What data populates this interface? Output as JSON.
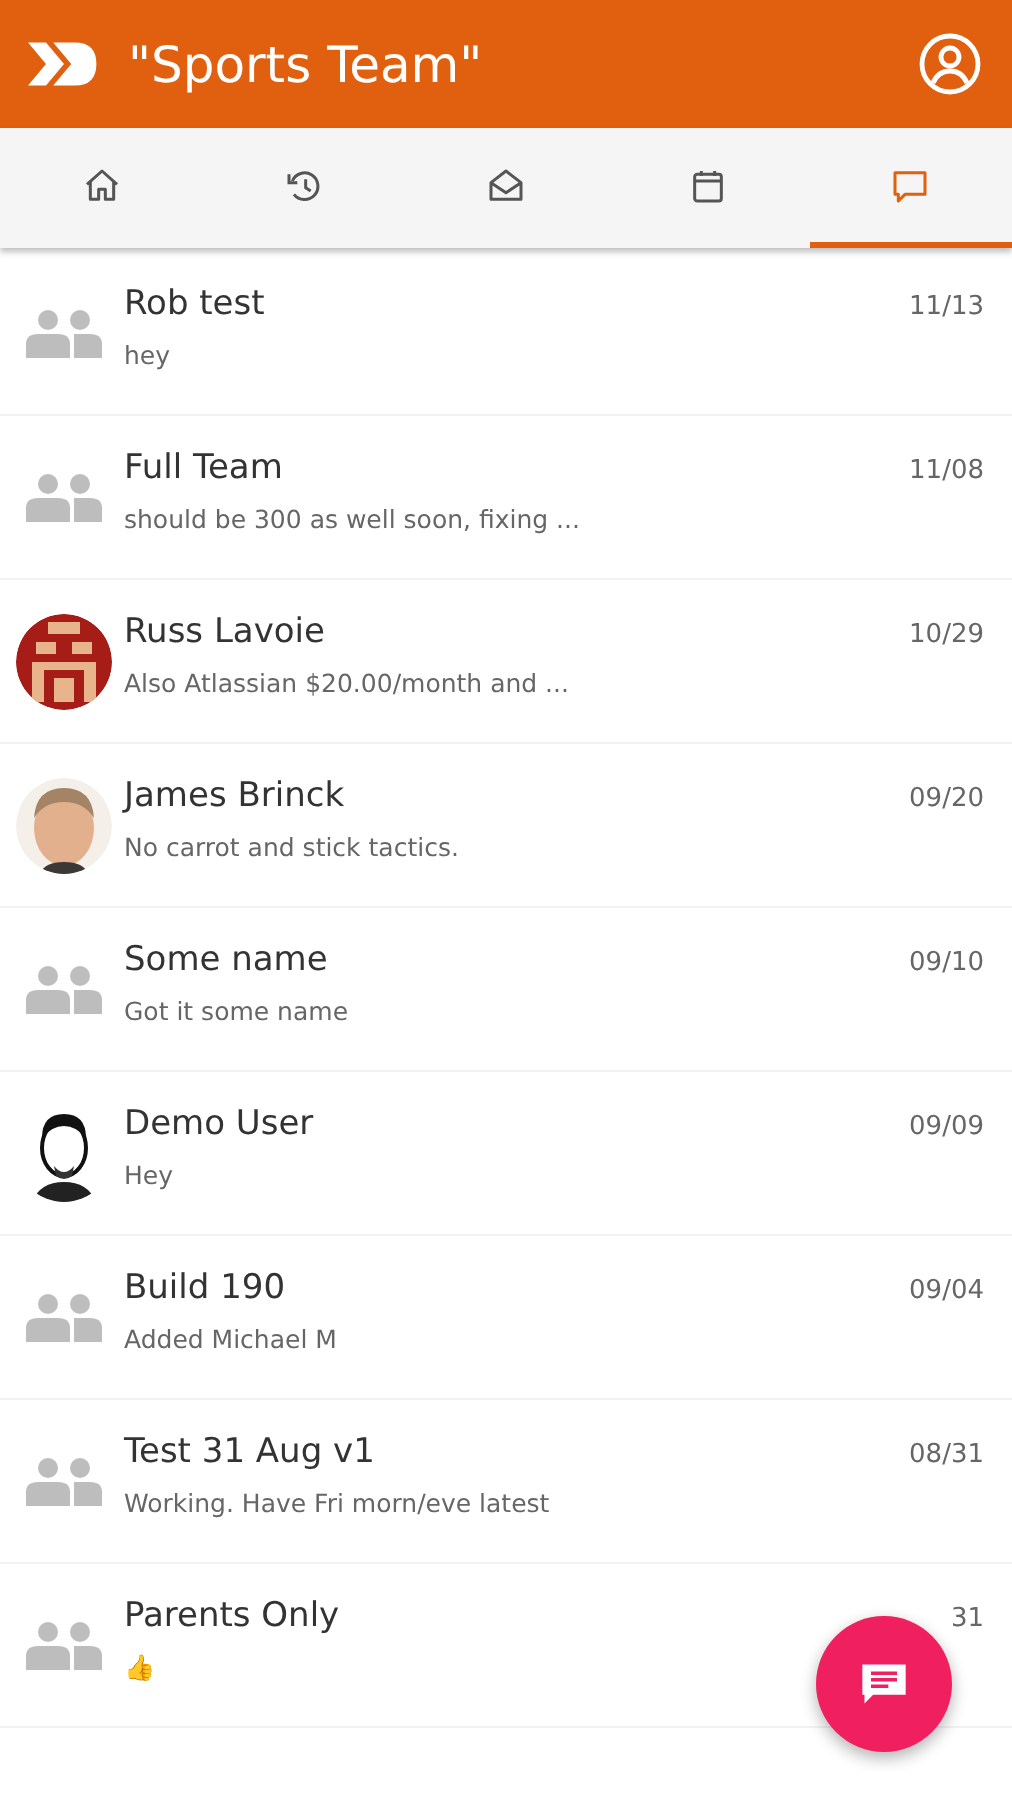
{
  "header": {
    "title": "\"Sports Team\""
  },
  "tabs": [
    {
      "kind": "home",
      "selected": false
    },
    {
      "kind": "history",
      "selected": false
    },
    {
      "kind": "inbox",
      "selected": false
    },
    {
      "kind": "calendar",
      "selected": false
    },
    {
      "kind": "chat",
      "selected": true
    }
  ],
  "conversations": [
    {
      "kind": "group",
      "name": "Rob test",
      "preview": "hey",
      "date": "11/13"
    },
    {
      "kind": "group",
      "name": "Full Team",
      "preview": "should be 300 as well soon, fixing ...",
      "date": "11/08"
    },
    {
      "kind": "pixel",
      "name": "Russ Lavoie",
      "preview": "Also Atlassian $20.00/month and ...",
      "date": "10/29"
    },
    {
      "name": "James Brinck",
      "preview": "No carrot and stick tactics.",
      "date": "09/20"
    },
    {
      "kind": "group",
      "name": "Some name",
      "preview": "Got it some name",
      "date": "09/10"
    },
    {
      "kind": "sketch",
      "name": "Demo User",
      "preview": "Hey",
      "date": "09/09"
    },
    {
      "kind": "group",
      "name": "Build 190",
      "preview": "Added Michael M",
      "date": "09/04"
    },
    {
      "kind": "group",
      "name": "Test 31 Aug v1",
      "preview": "Working. Have Fri morn/eve latest",
      "date": "08/31"
    },
    {
      "kind": "group",
      "name": "Parents Only",
      "preview": "👍",
      "date": "31"
    }
  ]
}
